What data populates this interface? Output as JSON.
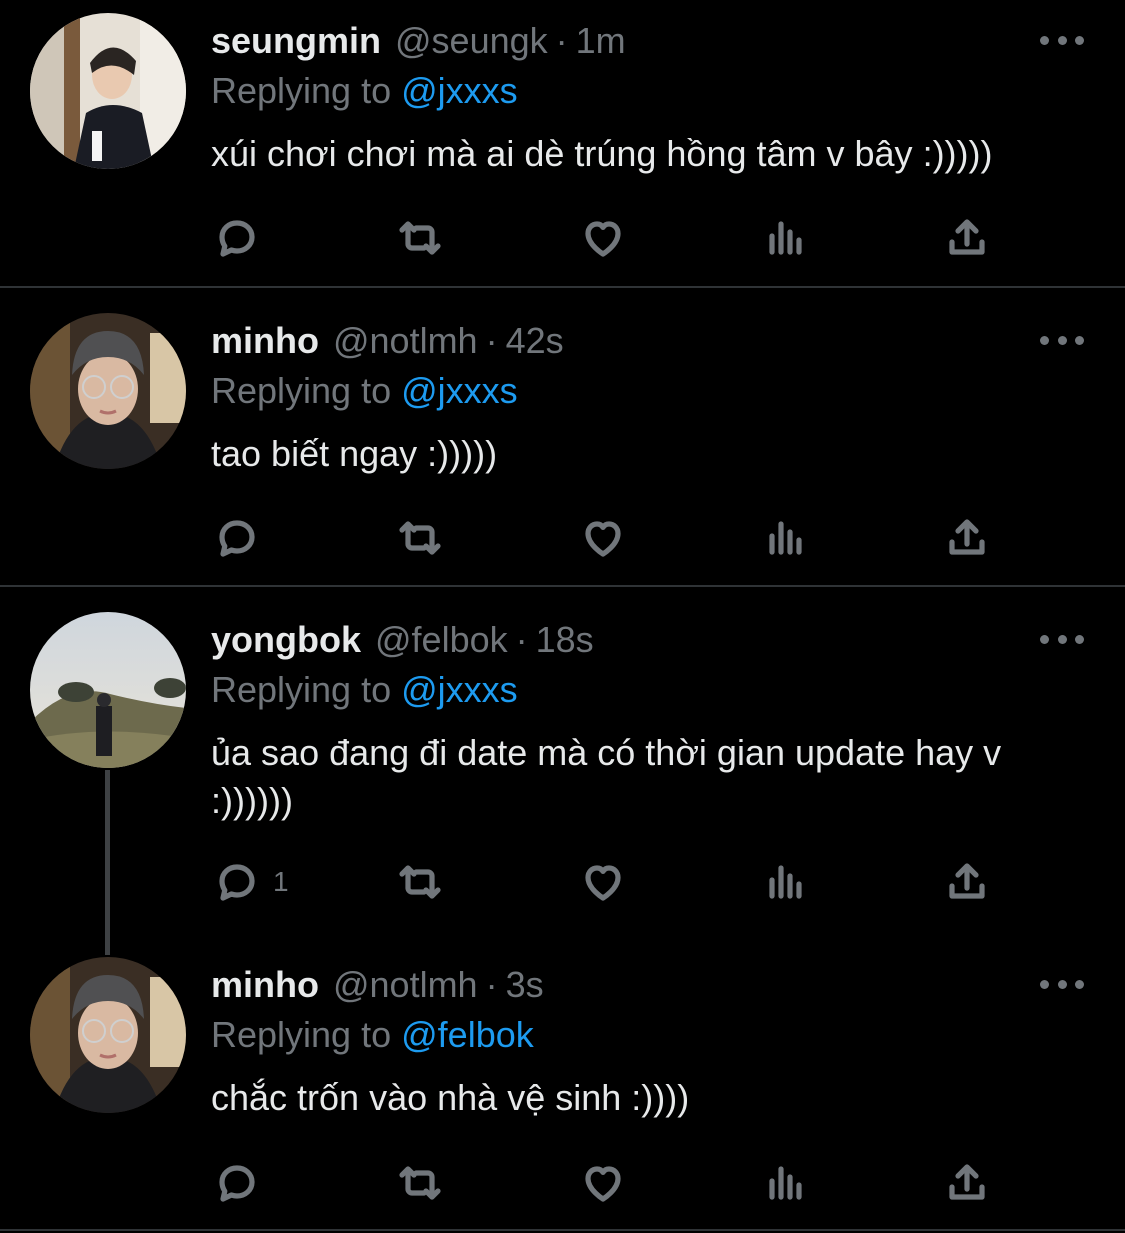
{
  "colors": {
    "background": "#000000",
    "text": "#e7e9ea",
    "muted": "#71767b",
    "accent": "#1d9bf0",
    "divider": "#2f3336"
  },
  "icons": [
    "more-icon",
    "reply-icon",
    "retweet-icon",
    "like-icon",
    "analytics-icon",
    "share-icon"
  ],
  "tweets": [
    {
      "name": "seungmin",
      "handle": "@seungk",
      "separator": "·",
      "time": "1m",
      "replying_prefix": "Replying to",
      "replying_to": "@jxxxs",
      "text": "xúi chơi chơi mà ai dè trúng hồng tâm v bây :)))))",
      "reply_count": ""
    },
    {
      "name": "minho",
      "handle": "@notlmh",
      "separator": "·",
      "time": "42s",
      "replying_prefix": "Replying to",
      "replying_to": "@jxxxs",
      "text": "tao biết ngay :)))))",
      "reply_count": ""
    },
    {
      "name": "yongbok",
      "handle": "@felbok",
      "separator": "·",
      "time": "18s",
      "replying_prefix": "Replying to",
      "replying_to": "@jxxxs",
      "text": "ủa sao đang đi date mà có thời gian update hay v :))))))",
      "reply_count": "1"
    },
    {
      "name": "minho",
      "handle": "@notlmh",
      "separator": "·",
      "time": "3s",
      "replying_prefix": "Replying to",
      "replying_to": "@felbok",
      "text": "chắc trốn vào nhà vệ sinh :))))",
      "reply_count": ""
    }
  ]
}
